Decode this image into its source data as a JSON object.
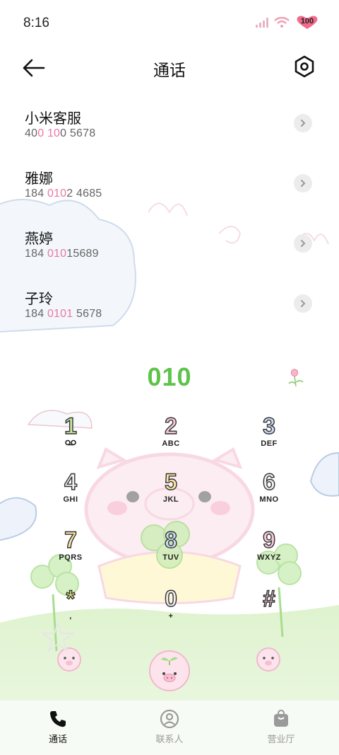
{
  "status_bar": {
    "time": "8:16",
    "battery": "100"
  },
  "header": {
    "title": "通话"
  },
  "contacts": [
    {
      "name": "小米客服",
      "number_parts": [
        "40",
        "0 ",
        "10",
        "0 5678"
      ]
    },
    {
      "name": "雅娜",
      "number_parts": [
        "184 ",
        "010",
        "2 4685",
        ""
      ]
    },
    {
      "name": "燕婷",
      "number_parts": [
        "184 ",
        "010",
        "15689",
        ""
      ]
    },
    {
      "name": "子玲",
      "number_parts": [
        "184 ",
        "0101",
        " 5678",
        ""
      ]
    }
  ],
  "dialpad": {
    "input": "010",
    "keys": [
      {
        "digit": "1",
        "letters": "",
        "color": "#c8e6a0"
      },
      {
        "digit": "2",
        "letters": "ABC",
        "color": "#f6c8d8"
      },
      {
        "digit": "3",
        "letters": "DEF",
        "color": "#c9dbf2"
      },
      {
        "digit": "4",
        "letters": "GHI",
        "color": "#eeeeee"
      },
      {
        "digit": "5",
        "letters": "JKL",
        "color": "#fbe7a4"
      },
      {
        "digit": "6",
        "letters": "MNO",
        "color": "#eeeeee"
      },
      {
        "digit": "7",
        "letters": "PQRS",
        "color": "#fbe7a4"
      },
      {
        "digit": "8",
        "letters": "TUV",
        "color": "#c9dbf2"
      },
      {
        "digit": "9",
        "letters": "WXYZ",
        "color": "#f6c8d8"
      },
      {
        "digit": "*",
        "letters": ",",
        "color": "#e8ee7a"
      },
      {
        "digit": "0",
        "letters": "+",
        "color": "#eeeeee"
      },
      {
        "digit": "#",
        "letters": "",
        "color": "#f6c8d8"
      }
    ]
  },
  "bottom_nav": [
    {
      "label": "通话",
      "icon": "phone-icon",
      "active": true
    },
    {
      "label": "联系人",
      "icon": "contacts-icon",
      "active": false
    },
    {
      "label": "营业厅",
      "icon": "shopping-bag-icon",
      "active": false
    }
  ],
  "colors": {
    "accent_green": "#5ec34a",
    "highlight_pink": "#e879a8",
    "inactive_gray": "#9a9a9a"
  }
}
